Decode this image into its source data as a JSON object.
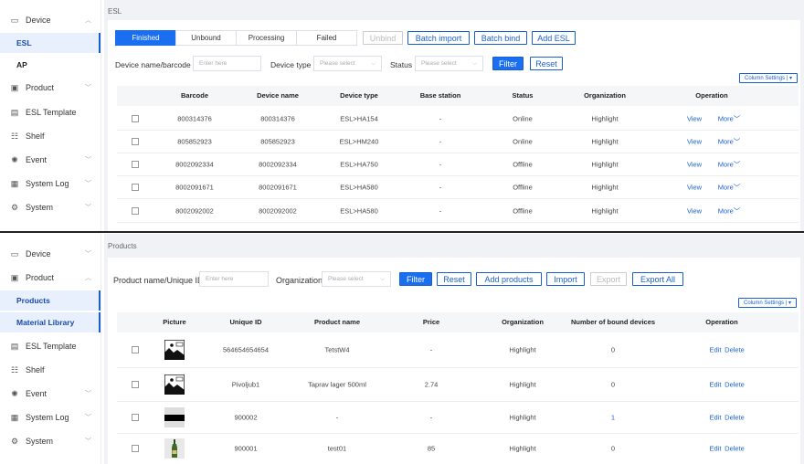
{
  "esl_screen": {
    "sidebar": {
      "items": [
        {
          "label": "Device",
          "icon": "device-icon",
          "chevron": "^"
        },
        {
          "label": "ESL"
        },
        {
          "label": "AP"
        },
        {
          "label": "Product",
          "icon": "product-icon",
          "chevron": "v"
        },
        {
          "label": "ESL Template",
          "icon": "template-icon"
        },
        {
          "label": "Shelf",
          "icon": "shelf-icon"
        },
        {
          "label": "Event",
          "icon": "event-icon",
          "chevron": "v"
        },
        {
          "label": "System Log",
          "icon": "log-icon",
          "chevron": "v"
        },
        {
          "label": "System",
          "icon": "system-icon",
          "chevron": "v"
        }
      ]
    },
    "breadcrumb": "ESL",
    "tabs": [
      "Finished",
      "Unbound",
      "Processing",
      "Failed"
    ],
    "actions": {
      "unbind": "Unbind",
      "batch_import": "Batch import",
      "batch_bind": "Batch bind",
      "add_esl": "Add ESL"
    },
    "filters": {
      "device_label": "Device name/barcode",
      "device_placeholder": "Enter here",
      "type_label": "Device type",
      "type_placeholder": "Please select",
      "status_label": "Status",
      "status_placeholder": "Please select",
      "filter": "Filter",
      "reset": "Reset"
    },
    "column_settings": "Column Settings |",
    "columns": [
      "Barcode",
      "Device name",
      "Device type",
      "Base station",
      "Status",
      "Organization",
      "Operation"
    ],
    "rows": [
      {
        "barcode": "800314376",
        "name": "800314376",
        "type": "ESL>HA154",
        "base": "-",
        "status": "Online",
        "org": "Highlight",
        "view": "View",
        "more": "More"
      },
      {
        "barcode": "805852923",
        "name": "805852923",
        "type": "ESL>HM240",
        "base": "-",
        "status": "Online",
        "org": "Highlight",
        "view": "View",
        "more": "More"
      },
      {
        "barcode": "8002092334",
        "name": "8002092334",
        "type": "ESL>HA750",
        "base": "-",
        "status": "Offline",
        "org": "Highlight",
        "view": "View",
        "more": "More"
      },
      {
        "barcode": "8002091671",
        "name": "8002091671",
        "type": "ESL>HA580",
        "base": "-",
        "status": "Offline",
        "org": "Highlight",
        "view": "View",
        "more": "More"
      },
      {
        "barcode": "8002092002",
        "name": "8002092002",
        "type": "ESL>HA580",
        "base": "-",
        "status": "Offline",
        "org": "Highlight",
        "view": "View",
        "more": "More"
      }
    ]
  },
  "products_screen": {
    "sidebar": {
      "items": [
        {
          "label": "Device",
          "icon": "device-icon",
          "chevron": "v"
        },
        {
          "label": "Product",
          "icon": "product-icon",
          "chevron": "^"
        },
        {
          "label": "Products"
        },
        {
          "label": "Material Library"
        },
        {
          "label": "ESL Template",
          "icon": "template-icon"
        },
        {
          "label": "Shelf",
          "icon": "shelf-icon"
        },
        {
          "label": "Event",
          "icon": "event-icon",
          "chevron": "v"
        },
        {
          "label": "System Log",
          "icon": "log-icon",
          "chevron": "v"
        },
        {
          "label": "System",
          "icon": "system-icon",
          "chevron": "v"
        }
      ]
    },
    "breadcrumb": "Products",
    "filters": {
      "name_label": "Product name/Unique ID",
      "name_placeholder": "Enter here",
      "org_label": "Organization",
      "org_placeholder": "Please select",
      "filter": "Filter",
      "reset": "Reset",
      "add": "Add products",
      "import": "Import",
      "export": "Export",
      "export_all": "Export All"
    },
    "column_settings": "Column Settings |",
    "columns": [
      "Picture",
      "Unique ID",
      "Product name",
      "Price",
      "Organization",
      "Number of bound devices",
      "Operation"
    ],
    "rows": [
      {
        "picture": "placeholder-image",
        "uid": "564654654654",
        "name": "TetstW4",
        "price": "-",
        "org": "Highlight",
        "bound": "0",
        "edit": "Edit",
        "delete": "Delete"
      },
      {
        "picture": "placeholder-image",
        "uid": "Pivoljub1",
        "name": "Taprav lager 500ml",
        "price": "2.74",
        "org": "Highlight",
        "bound": "0",
        "edit": "Edit",
        "delete": "Delete"
      },
      {
        "picture": "black-bar-image",
        "uid": "900002",
        "name": "-",
        "price": "-",
        "org": "Highlight",
        "bound": "1",
        "edit": "Edit",
        "delete": "Delete"
      },
      {
        "picture": "bottle-image",
        "uid": "900001",
        "name": "test01",
        "price": "85",
        "org": "Highlight",
        "bound": "0",
        "edit": "Edit",
        "delete": "Delete"
      }
    ]
  },
  "colors": {
    "primary": "#1a6ef0",
    "link": "#1a5fd0",
    "active_bg": "#e8f0fd",
    "page_bg": "#f0f2f5"
  }
}
